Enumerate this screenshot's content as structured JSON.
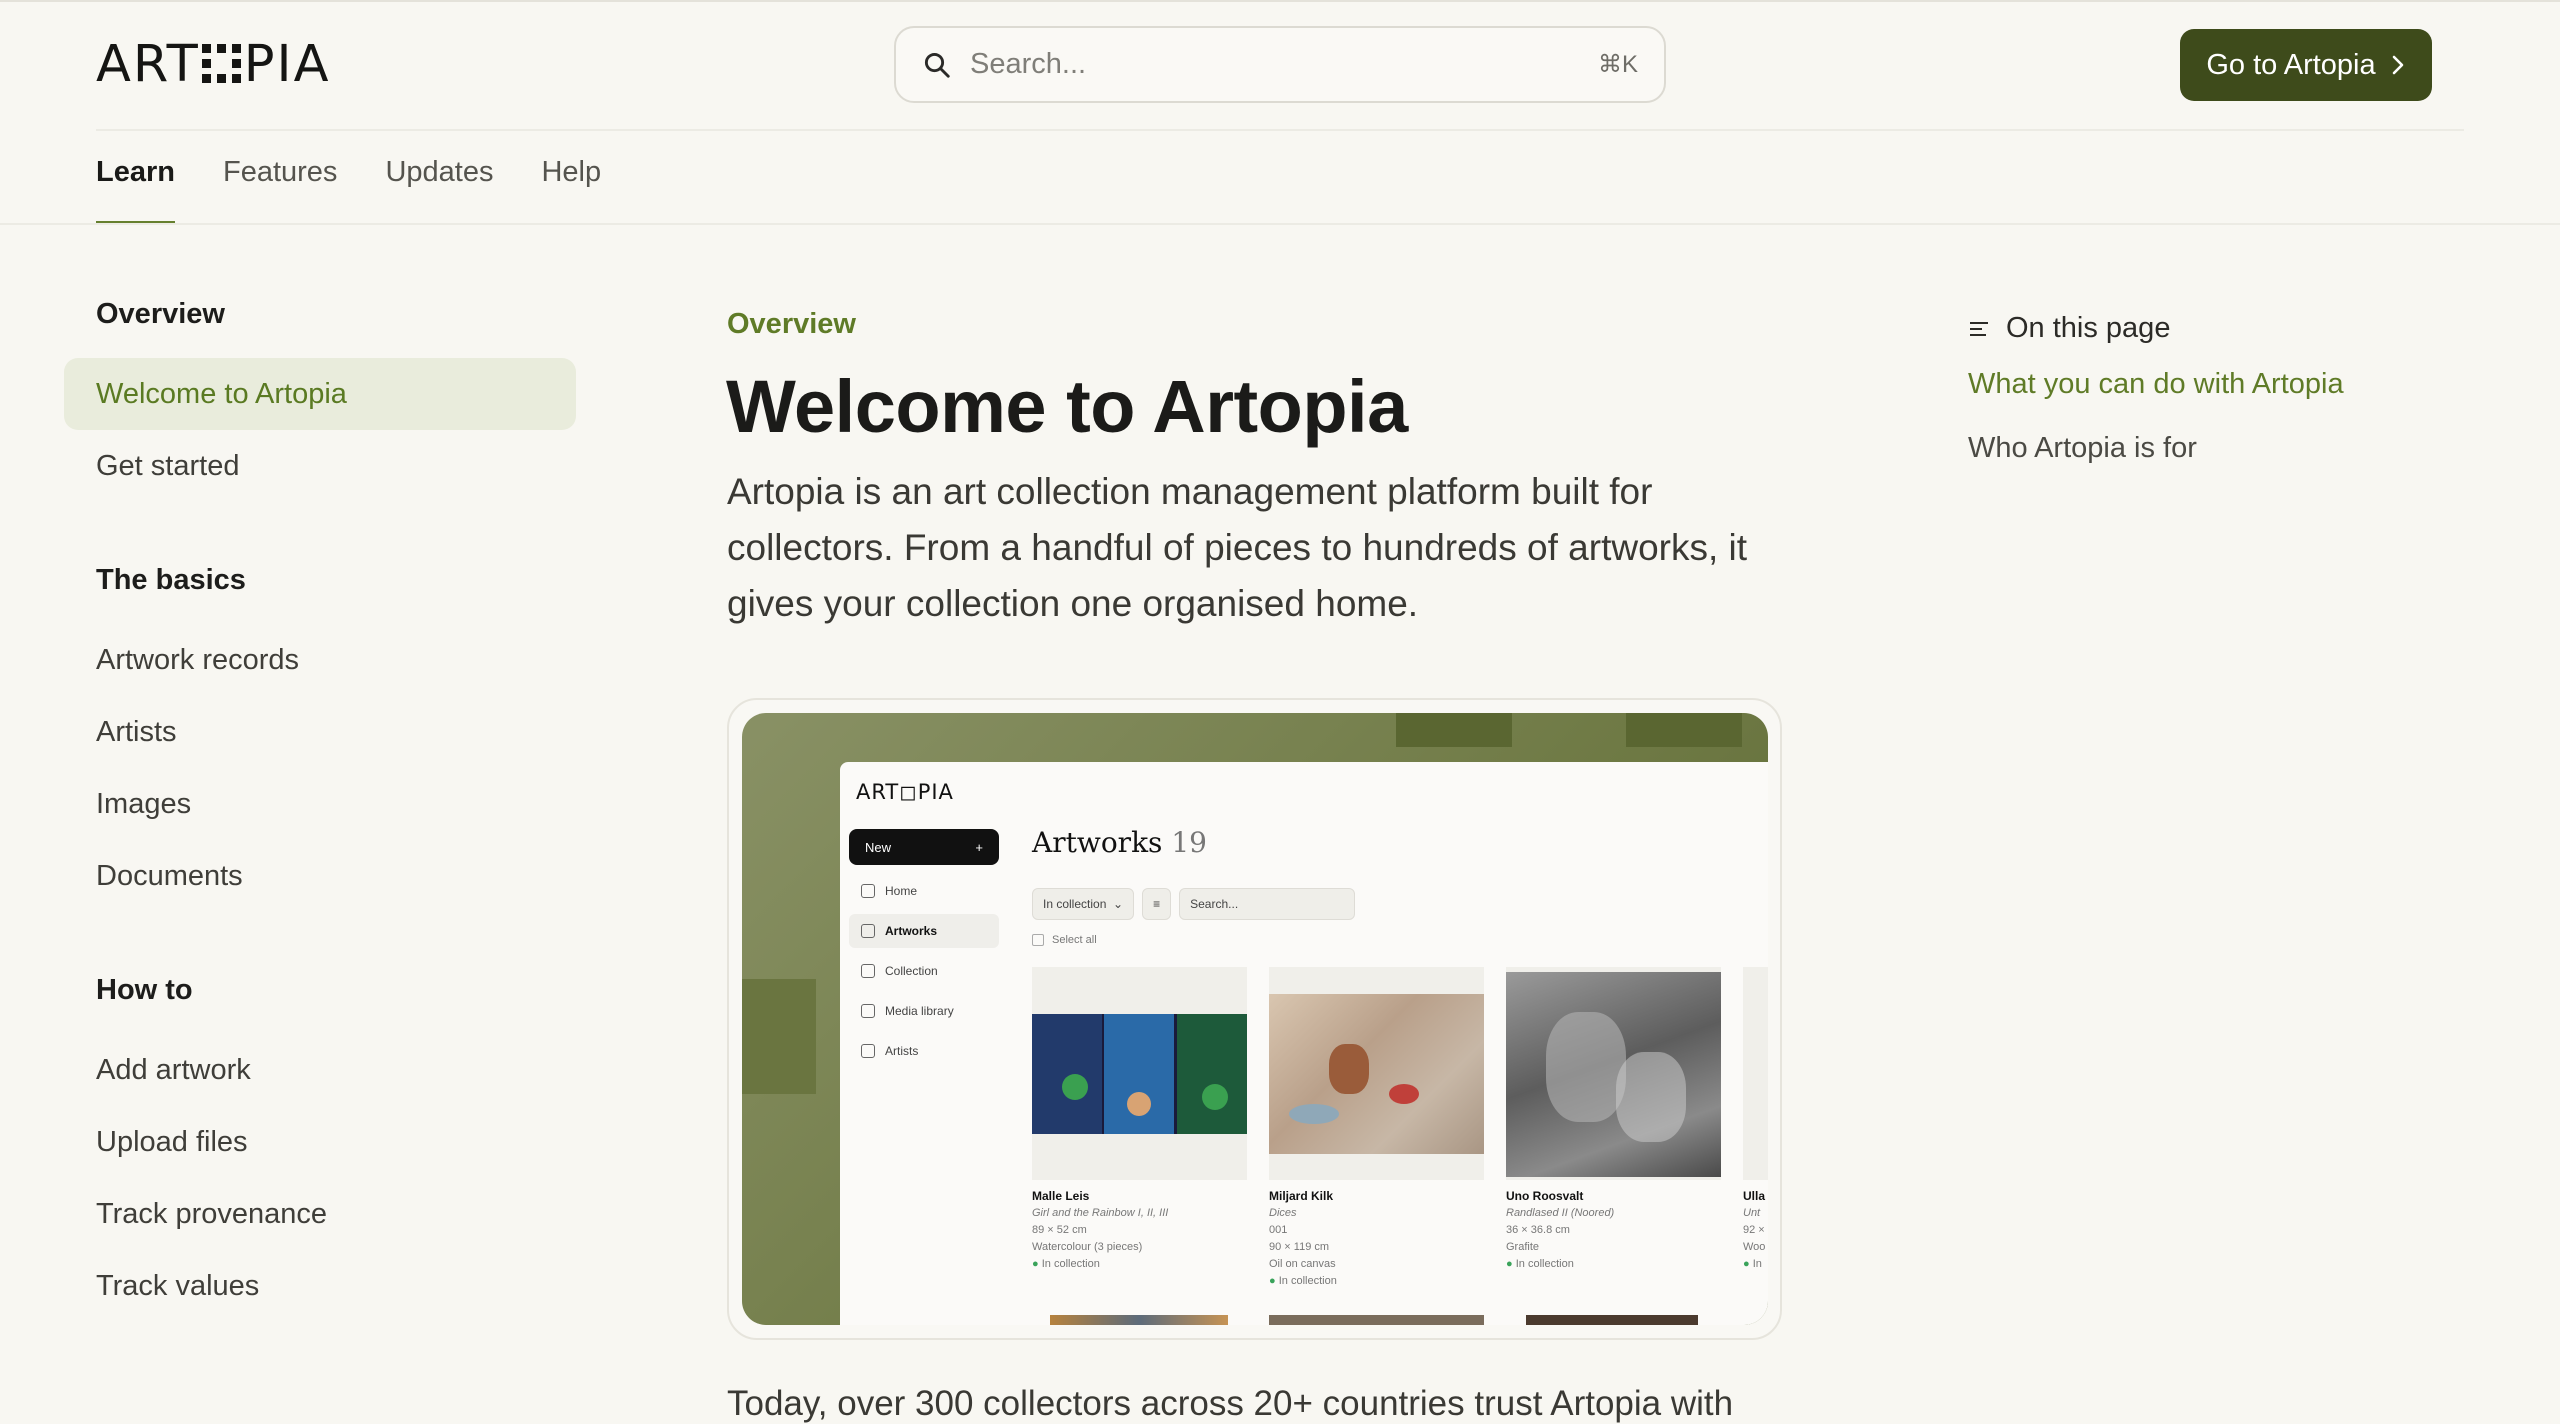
{
  "brand": {
    "logo_text": "ART◻PIA",
    "accent": "#5f7b27",
    "button_color": "#3e4b1b"
  },
  "header": {
    "search_placeholder": "Search...",
    "search_shortcut": "⌘K",
    "cta_label": "Go to Artopia"
  },
  "tabs": [
    {
      "label": "Learn",
      "active": true
    },
    {
      "label": "Features"
    },
    {
      "label": "Updates"
    },
    {
      "label": "Help"
    }
  ],
  "sidebar": {
    "groups": [
      {
        "title": "Overview",
        "items": [
          "Welcome to Artopia",
          "Get started"
        ],
        "active": "Welcome to Artopia"
      },
      {
        "title": "The basics",
        "items": [
          "Artwork records",
          "Artists",
          "Images",
          "Documents"
        ]
      },
      {
        "title": "How to",
        "items": [
          "Add artwork",
          "Upload files",
          "Track provenance",
          "Track values"
        ]
      }
    ]
  },
  "main": {
    "eyebrow": "Overview",
    "title": "Welcome to Artopia",
    "lead": "Artopia is an art collection management platform built for collectors. From a handful of pieces to hundreds of artworks, it gives your collection one organised home.",
    "tail": "Today, over 300 collectors across 20+ countries trust Artopia with"
  },
  "screenshot": {
    "logo": "ART◻PIA",
    "new_label": "New",
    "new_plus": "+",
    "nav": [
      "Home",
      "Artworks",
      "Collection",
      "Media library",
      "Artists"
    ],
    "nav_active": "Artworks",
    "title": "Artworks",
    "count": "19",
    "filter_label": "In collection",
    "search_placeholder": "Search...",
    "select_all": "Select all",
    "cards": [
      {
        "artist": "Malle Leis",
        "title": "Girl and the Rainbow I, II, III",
        "size": "89 × 52 cm",
        "medium": "Watercolour (3 pieces)",
        "status": "In collection"
      },
      {
        "artist": "Miljard Kilk",
        "title": "Dices",
        "size": "001",
        "medium": "90 × 119 cm",
        "extra": "Oil on canvas",
        "status": "In collection"
      },
      {
        "artist": "Uno Roosvalt",
        "title": "Randlased II (Noored)",
        "size": "36 × 36.8 cm",
        "medium": "Grafite",
        "status": "In collection"
      },
      {
        "artist": "Ulla",
        "title": "Unt",
        "size": "92 ×",
        "medium": "Woo",
        "status": "In"
      }
    ]
  },
  "toc": {
    "heading": "On this page",
    "items": [
      "What you can do with Artopia",
      "Who Artopia is for"
    ]
  }
}
